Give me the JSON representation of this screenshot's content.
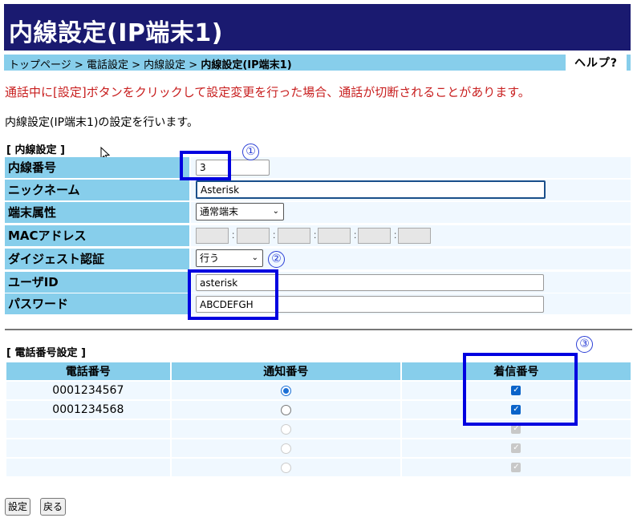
{
  "page": {
    "title": "内線設定(IP端末1)",
    "help_label": "ヘルプ?",
    "breadcrumbs": [
      "トップページ",
      "電話設定",
      "内線設定",
      "内線設定(IP端末1)"
    ],
    "crumb_sep": ">",
    "warning": "通話中に[設定]ボタンをクリックして設定変更を行った場合、通話が切断されることがあります。",
    "description": "内線設定(IP端末1)の設定を行います。"
  },
  "extension": {
    "section_title": "[ 内線設定 ]",
    "number_label": "内線番号",
    "number_value": "3",
    "nickname_label": "ニックネーム",
    "nickname_value": "Asterisk",
    "type_label": "端末属性",
    "type_value": "通常端末",
    "mac_label": "MACアドレス",
    "mac_sep": ":",
    "digest_label": "ダイジェスト認証",
    "digest_value": "行う",
    "userid_label": "ユーザID",
    "userid_value": "asterisk",
    "password_label": "パスワード",
    "password_value": "ABCDEFGH"
  },
  "phone_numbers": {
    "section_title": "[ 電話番号設定 ]",
    "headers": [
      "電話番号",
      "通知番号",
      "着信番号"
    ],
    "rows": [
      {
        "number": "0001234567",
        "notify": true,
        "notify_enabled": true,
        "incoming": true,
        "incoming_enabled": true
      },
      {
        "number": "0001234568",
        "notify": false,
        "notify_enabled": true,
        "incoming": true,
        "incoming_enabled": true
      },
      {
        "number": "",
        "notify": false,
        "notify_enabled": false,
        "incoming": true,
        "incoming_enabled": false
      },
      {
        "number": "",
        "notify": false,
        "notify_enabled": false,
        "incoming": true,
        "incoming_enabled": false
      },
      {
        "number": "",
        "notify": false,
        "notify_enabled": false,
        "incoming": true,
        "incoming_enabled": false
      }
    ]
  },
  "buttons": {
    "submit": "設定",
    "back": "戻る"
  },
  "annotations": {
    "one": "①",
    "two": "②",
    "three": "③"
  },
  "colors": {
    "title_bg": "#1a1a70",
    "header_bg": "#87ceeb",
    "warning": "#c81e1e",
    "annotation": "#0000e0"
  }
}
